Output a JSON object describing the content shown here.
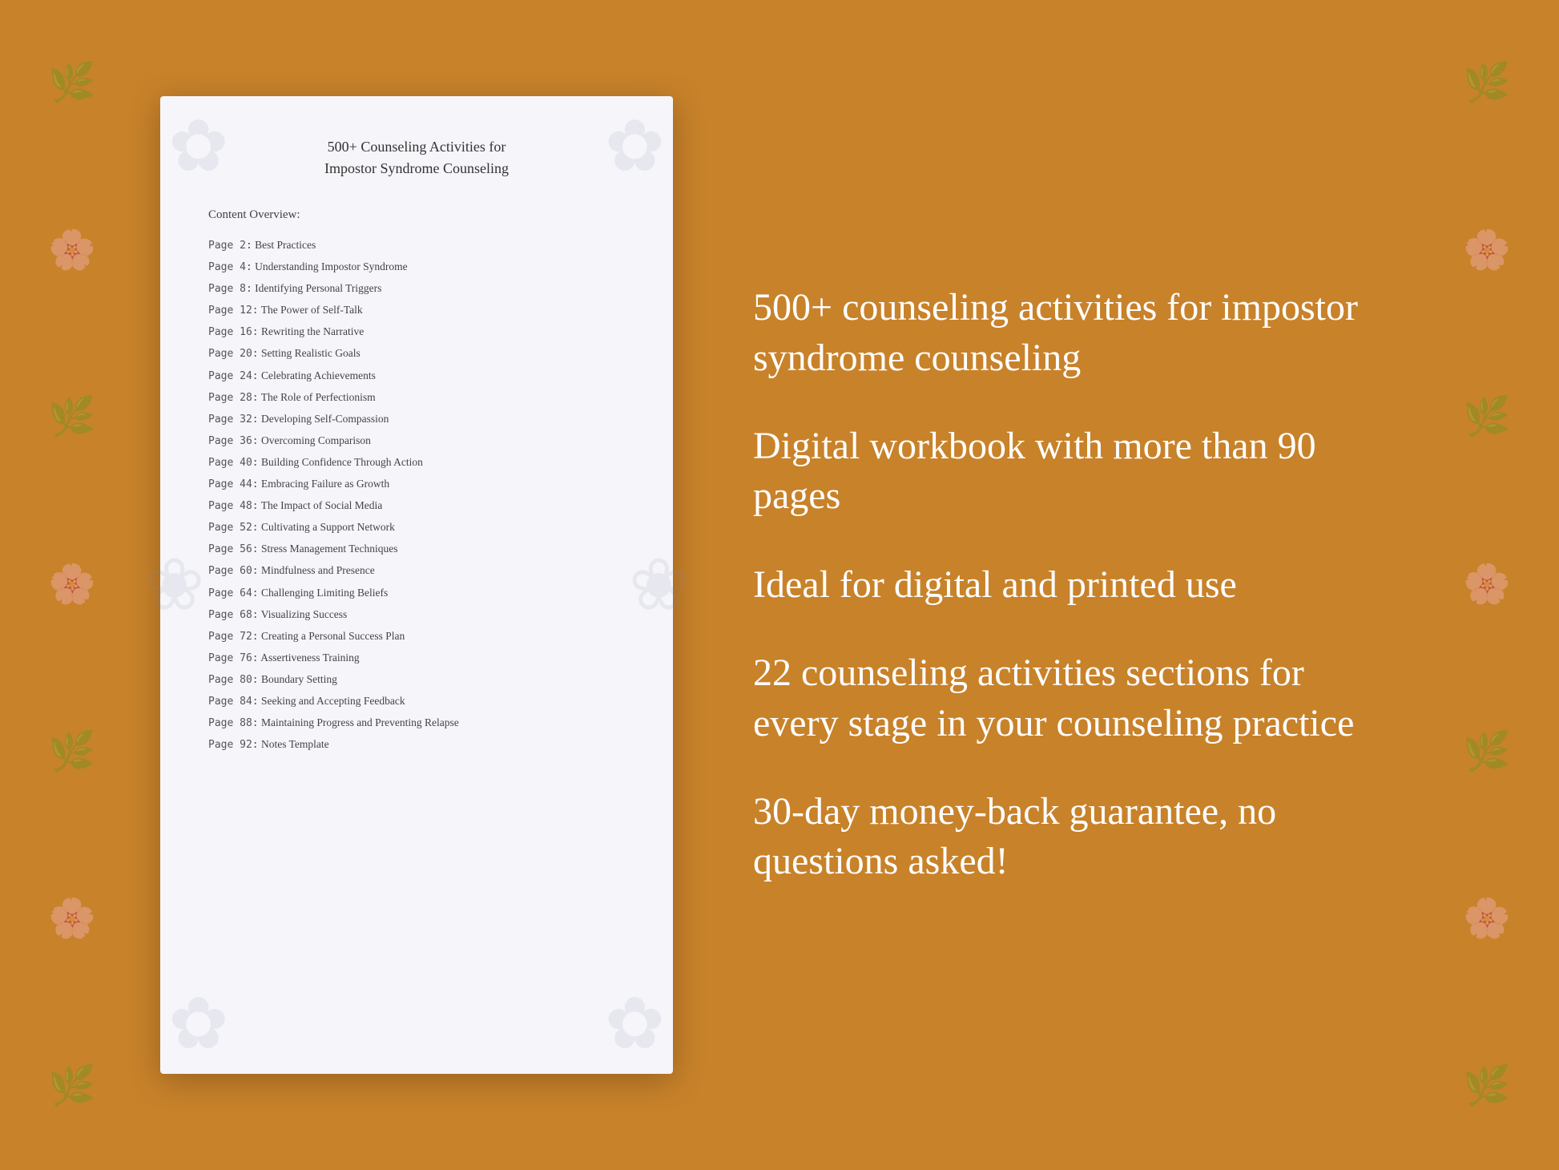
{
  "background": {
    "color": "#C8822A"
  },
  "document": {
    "title_line1": "500+ Counseling Activities for",
    "title_line2": "Impostor Syndrome Counseling",
    "section_header": "Content Overview:",
    "toc_entries": [
      {
        "page": "Page  2:",
        "topic": "Best Practices"
      },
      {
        "page": "Page  4:",
        "topic": "Understanding Impostor Syndrome"
      },
      {
        "page": "Page  8:",
        "topic": "Identifying Personal Triggers"
      },
      {
        "page": "Page 12:",
        "topic": "The Power of Self-Talk"
      },
      {
        "page": "Page 16:",
        "topic": "Rewriting the Narrative"
      },
      {
        "page": "Page 20:",
        "topic": "Setting Realistic Goals"
      },
      {
        "page": "Page 24:",
        "topic": "Celebrating Achievements"
      },
      {
        "page": "Page 28:",
        "topic": "The Role of Perfectionism"
      },
      {
        "page": "Page 32:",
        "topic": "Developing Self-Compassion"
      },
      {
        "page": "Page 36:",
        "topic": "Overcoming Comparison"
      },
      {
        "page": "Page 40:",
        "topic": "Building Confidence Through Action"
      },
      {
        "page": "Page 44:",
        "topic": "Embracing Failure as Growth"
      },
      {
        "page": "Page 48:",
        "topic": "The Impact of Social Media"
      },
      {
        "page": "Page 52:",
        "topic": "Cultivating a Support Network"
      },
      {
        "page": "Page 56:",
        "topic": "Stress Management Techniques"
      },
      {
        "page": "Page 60:",
        "topic": "Mindfulness and Presence"
      },
      {
        "page": "Page 64:",
        "topic": "Challenging Limiting Beliefs"
      },
      {
        "page": "Page 68:",
        "topic": "Visualizing Success"
      },
      {
        "page": "Page 72:",
        "topic": "Creating a Personal Success Plan"
      },
      {
        "page": "Page 76:",
        "topic": "Assertiveness Training"
      },
      {
        "page": "Page 80:",
        "topic": "Boundary Setting"
      },
      {
        "page": "Page 84:",
        "topic": "Seeking and Accepting Feedback"
      },
      {
        "page": "Page 88:",
        "topic": "Maintaining Progress and Preventing Relapse"
      },
      {
        "page": "Page 92:",
        "topic": "Notes Template"
      }
    ]
  },
  "features": [
    "500+ counseling activities for impostor syndrome counseling",
    "Digital workbook with more than 90 pages",
    "Ideal for digital and printed use",
    "22 counseling activities sections for every stage in your counseling practice",
    "30-day money-back guarantee, no questions asked!"
  ],
  "floral_symbol": "❀",
  "mandala_symbol": "✿"
}
